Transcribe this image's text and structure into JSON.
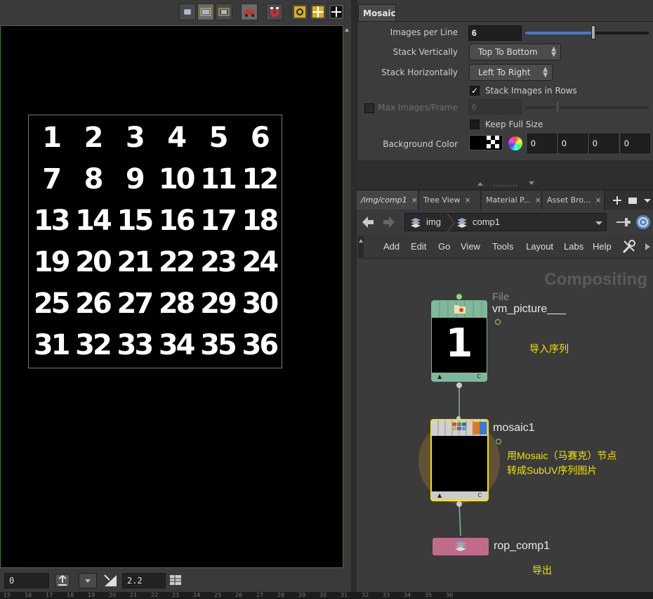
{
  "viewer": {
    "toolbar_icons": [
      "single-view-icon",
      "split-view-icon",
      "compare-view-icon",
      "render-car-icon",
      "magnet-icon",
      "fit-icon",
      "grid-icon",
      "crosshair-icon"
    ],
    "mosaic_numbers": [
      "1",
      "2",
      "3",
      "4",
      "5",
      "6",
      "7",
      "8",
      "9",
      "10",
      "11",
      "12",
      "13",
      "14",
      "15",
      "16",
      "17",
      "18",
      "19",
      "20",
      "21",
      "22",
      "23",
      "24",
      "25",
      "26",
      "27",
      "28",
      "29",
      "30",
      "31",
      "32",
      "33",
      "34",
      "35",
      "36"
    ],
    "bottom": {
      "frame_value": "0",
      "gamma_value": "2.2"
    },
    "timeline_ticks": [
      "15",
      "16",
      "17",
      "18",
      "19",
      "20",
      "21",
      "22",
      "23",
      "24",
      "25",
      "26",
      "27",
      "28",
      "29",
      "30",
      "31",
      "32",
      "33",
      "34",
      "35",
      "36"
    ]
  },
  "params": {
    "tab": "Mosaic",
    "images_per_line": {
      "label": "Images per Line",
      "value": "6",
      "slider_fraction": 0.55
    },
    "stack_vertically": {
      "label": "Stack Vertically",
      "value": "Top To Bottom"
    },
    "stack_horizontally": {
      "label": "Stack Horizontally",
      "value": "Left To Right"
    },
    "stack_images_in_rows": {
      "label": "Stack Images in Rows",
      "checked": true,
      "check": "✓"
    },
    "max_images_frame": {
      "label": "Max Images/Frame",
      "value": "6"
    },
    "keep_full_size": {
      "label": "Keep Full Size",
      "checked": false
    },
    "background_color": {
      "label": "Background Color",
      "values": [
        "0",
        "0",
        "0",
        "0"
      ]
    }
  },
  "network": {
    "tabs": [
      {
        "label": "/img/comp1"
      },
      {
        "label": "Tree View"
      },
      {
        "label": "Material P..."
      },
      {
        "label": "Asset Bro..."
      }
    ],
    "tab_close": "×",
    "path": {
      "root": "img",
      "current": "comp1"
    },
    "menu": [
      "Add",
      "Edit",
      "Go",
      "View",
      "Tools",
      "Layout",
      "Labs",
      "Help"
    ],
    "context_title": "Compositing",
    "nodes": {
      "file": {
        "type": "File",
        "name": "vm_picture___",
        "thumb_text": "1"
      },
      "mosaic": {
        "name": "mosaic1"
      },
      "rop": {
        "name": "rop_comp1"
      }
    },
    "notes": {
      "import": "导入序列",
      "mosaic_line1": "用Mosaic（马赛克）节点",
      "mosaic_line2": "转成SubUV序列图片",
      "export": "导出"
    },
    "colors": {
      "file_node": "#7fb89a",
      "rop_node": "#c06b8a",
      "selected_outline": "#f2e400",
      "note": "#f2e400"
    }
  }
}
